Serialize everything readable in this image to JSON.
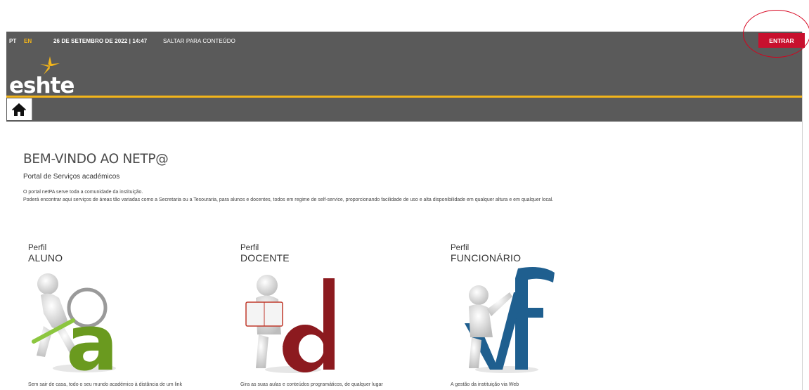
{
  "topbar": {
    "lang_pt": "PT",
    "lang_en": "EN",
    "datetime": "26 DE SETEMBRO DE 2022 | 14:47",
    "skip_link": "SALTAR PARA CONTEÚDO",
    "login_button": "ENTRAR"
  },
  "brand": {
    "logo_text": "eshte",
    "accent_yellow": "#f3b51a",
    "header_gray": "#5a5a5a",
    "login_red": "#c8102e"
  },
  "nav": {
    "home_icon": "home-icon"
  },
  "main": {
    "title": "BEM-VINDO AO NETP@",
    "subtitle": "Portal de Serviços académicos",
    "description_line1": "O portal netPA serve toda a comunidade da instituição.",
    "description_line2": "Poderá encontrar aqui serviços de áreas tão variadas como a Secretaria ou a Tesouraria, para alunos e docentes, todos em regime de self-service, proporcionando facilidade de uso e alta disponibilidade em qualquer altura e em qualquer local."
  },
  "profiles": [
    {
      "label_small": "Perfil",
      "label_big": "ALUNO",
      "letter": "a",
      "letter_color": "#6a9a1f",
      "caption": "Sem sair de casa, todo o seu mundo académico à distância de um link"
    },
    {
      "label_small": "Perfil",
      "label_big": "DOCENTE",
      "letter": "d",
      "letter_color": "#8c1a1f",
      "caption": "Gira as suas aulas e conteúdos programáticos, de qualquer lugar"
    },
    {
      "label_small": "Perfil",
      "label_big": "FUNCIONÁRIO",
      "letter": "f",
      "letter_color": "#1f5f8f",
      "caption": "A gestão da instituição via Web"
    }
  ]
}
